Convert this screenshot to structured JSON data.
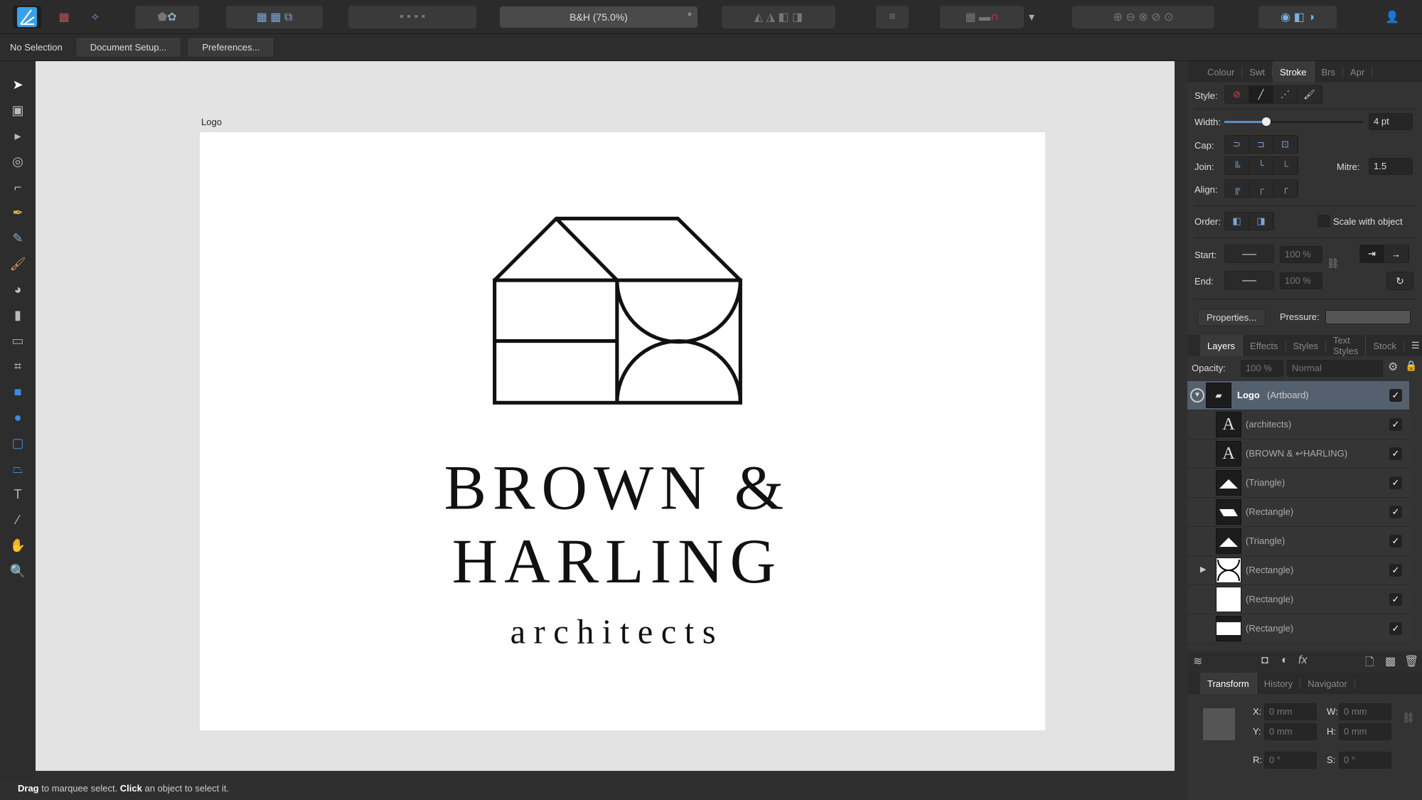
{
  "toolbar": {
    "doc_title": "B&H (75.0%)",
    "modified": "*"
  },
  "context": {
    "selection": "No Selection",
    "document_setup": "Document Setup...",
    "preferences": "Preferences..."
  },
  "artboard": {
    "label": "Logo",
    "line1": "BROWN &",
    "line2": "HARLING",
    "line3": "architects"
  },
  "status": {
    "drag": "Drag",
    "drag_text": " to marquee select. ",
    "click": "Click",
    "click_text": " an object to select it."
  },
  "stroke_panel": {
    "tabs": [
      "Colour",
      "Swt",
      "Stroke",
      "Brs",
      "Apr"
    ],
    "active_tab": "Stroke",
    "style_label": "Style:",
    "width_label": "Width:",
    "width_value": "4 pt",
    "width_fraction": 0.3,
    "cap_label": "Cap:",
    "join_label": "Join:",
    "mitre_label": "Mitre:",
    "mitre_value": "1.5",
    "align_label": "Align:",
    "order_label": "Order:",
    "scale_with_object": "Scale with object",
    "start_label": "Start:",
    "end_label": "End:",
    "start_pct": "100 %",
    "end_pct": "100 %",
    "properties": "Properties...",
    "pressure_label": "Pressure:"
  },
  "layers_panel": {
    "tabs": [
      "Layers",
      "Effects",
      "Styles",
      "Text Styles",
      "Stock"
    ],
    "active_tab": "Layers",
    "opacity_label": "Opacity:",
    "opacity_value": "100 %",
    "blend_mode": "Normal",
    "artboard_name": "Logo",
    "artboard_type": "(Artboard)",
    "layers": [
      {
        "name": "(architects)",
        "thumb": "A"
      },
      {
        "name": "(BROWN & ↩HARLING)",
        "thumb": "A"
      },
      {
        "name": "(Triangle)",
        "thumb": "triangle"
      },
      {
        "name": "(Rectangle)",
        "thumb": "parallelogram"
      },
      {
        "name": "(Triangle)",
        "thumb": "triangle"
      },
      {
        "name": "(Rectangle)",
        "thumb": "arcs"
      },
      {
        "name": "(Rectangle)",
        "thumb": "square"
      },
      {
        "name": "(Rectangle)",
        "thumb": "rect"
      }
    ],
    "check": "✓"
  },
  "transform_panel": {
    "tabs": [
      "Transform",
      "History",
      "Navigator"
    ],
    "active_tab": "Transform",
    "x_label": "X:",
    "x": "0 mm",
    "y_label": "Y:",
    "y": "0 mm",
    "w_label": "W:",
    "w": "0 mm",
    "h_label": "H:",
    "h": "0 mm",
    "r_label": "R:",
    "r": "0 °",
    "s_label": "S:",
    "s": "0 °"
  },
  "colors": {
    "accent": "#5b8fc7",
    "panel": "#333333",
    "canvas": "#e3e3e3"
  }
}
